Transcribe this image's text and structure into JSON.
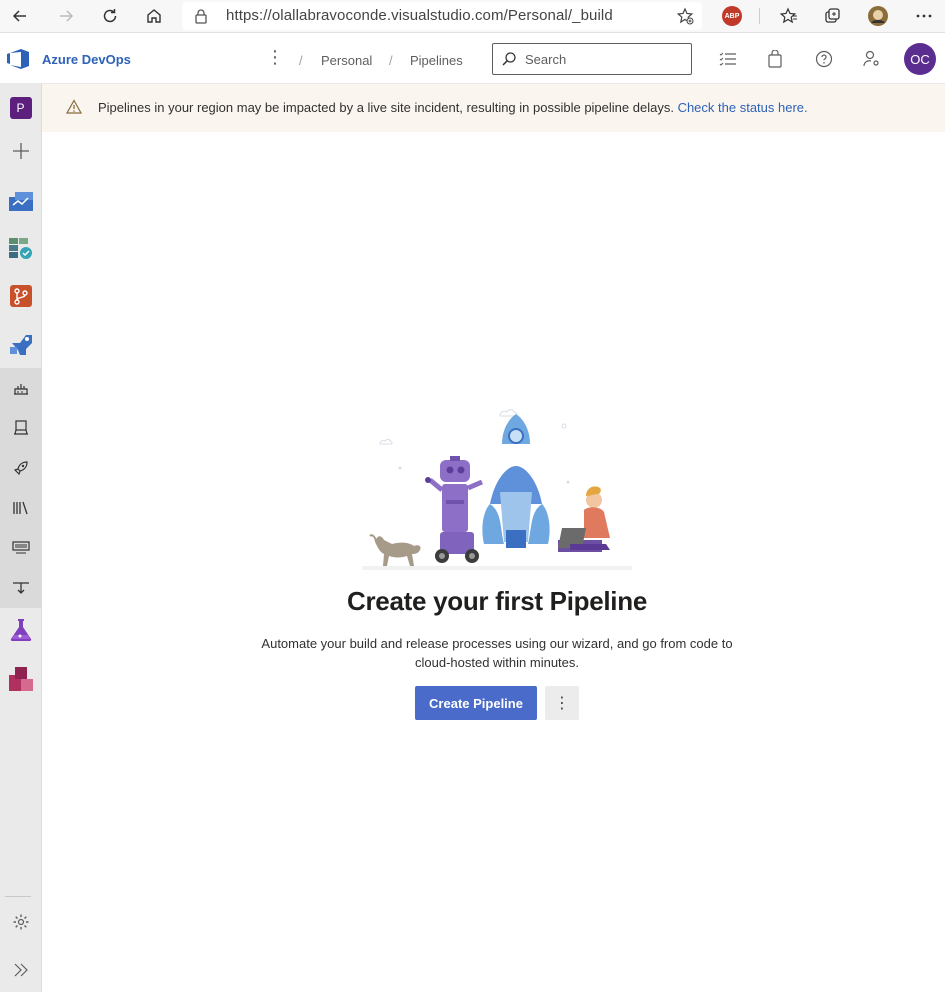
{
  "browser": {
    "url": "https://olallabravoconde.visualstudio.com/Personal/_build",
    "abp_label": "ABP"
  },
  "header": {
    "brand": "Azure DevOps",
    "breadcrumb": [
      "Personal",
      "Pipelines"
    ],
    "breadcrumb_separator": "/",
    "search_placeholder": "Search",
    "avatar_initials": "OC"
  },
  "sidebar": {
    "project_initial": "P",
    "items": [
      "add-icon",
      "boards-icon",
      "test-plans-check-icon",
      "repos-icon",
      "pipelines-icon",
      "builds-icon",
      "environments-icon",
      "releases-icon",
      "library-icon",
      "task-groups-icon",
      "deployment-groups-icon",
      "test-plans-icon",
      "artifacts-icon"
    ],
    "settings_icon": "gear-icon",
    "collapse_icon": "chevron-double-right-icon"
  },
  "banner": {
    "message": "Pipelines in your region may be impacted by a live site incident, resulting in possible pipeline delays.",
    "link_text": "Check the status here."
  },
  "main": {
    "title": "Create your first Pipeline",
    "description": "Automate your build and release processes using our wizard, and go from code to cloud-hosted within minutes.",
    "create_button": "Create Pipeline",
    "more_button": "⋮"
  },
  "colors": {
    "brand_blue": "#2d62b8",
    "primary_button": "#4a6bc9",
    "avatar": "#5c2d91",
    "banner_bg": "#fbf5ef",
    "sidebar_bg": "#eaeaea"
  }
}
